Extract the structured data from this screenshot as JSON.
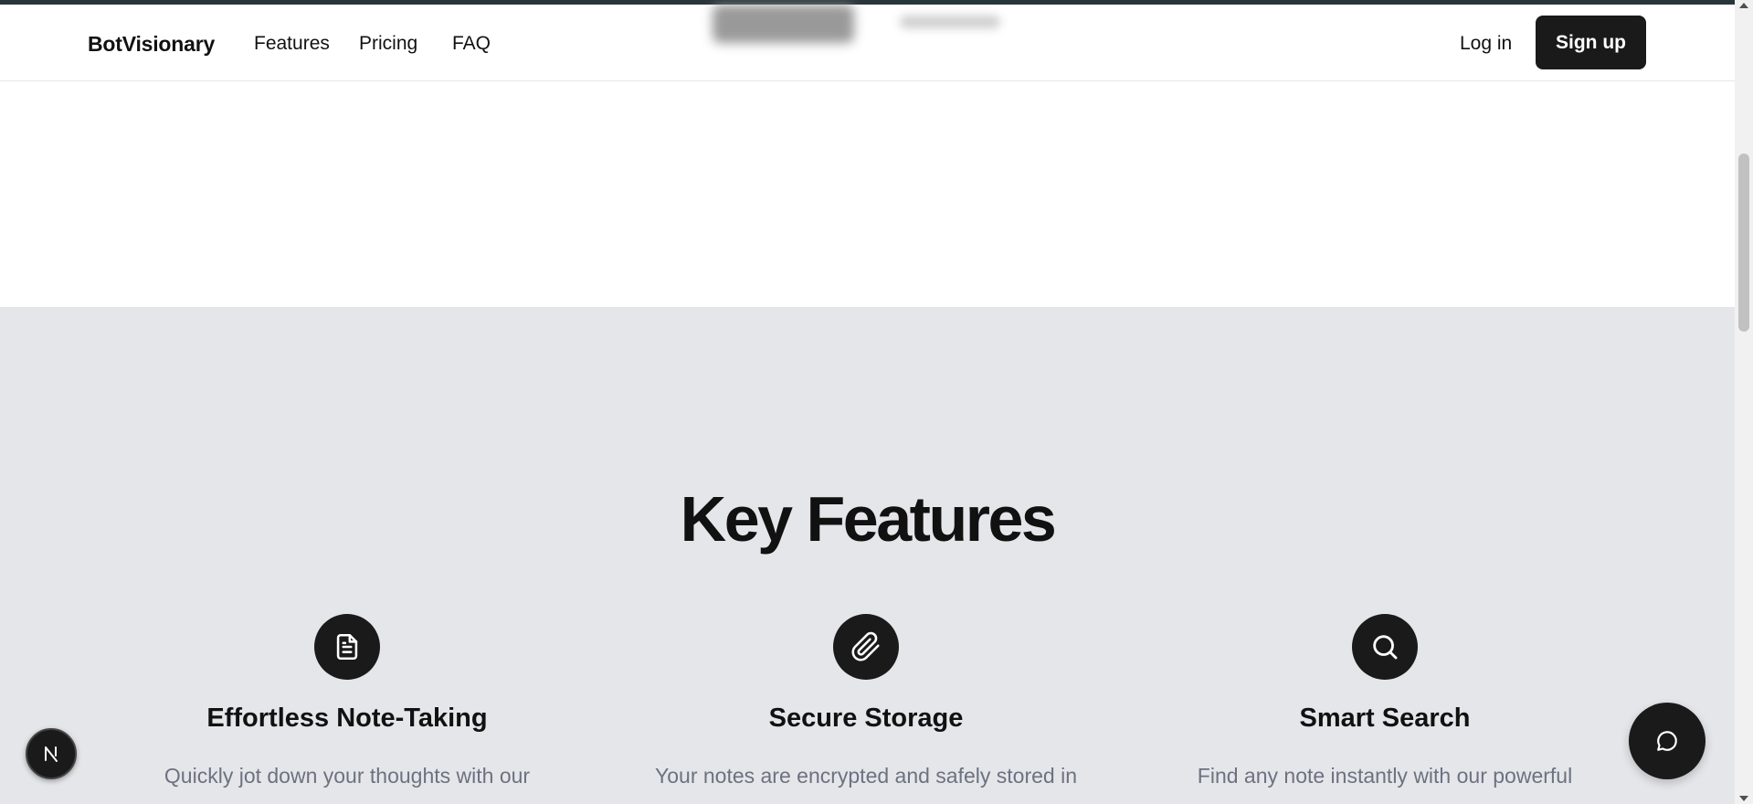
{
  "nav": {
    "brand": "BotVisionary",
    "links": [
      "Features",
      "Pricing",
      "FAQ"
    ],
    "login_label": "Log in",
    "signup_label": "Sign up"
  },
  "features_section": {
    "title": "Key Features",
    "items": [
      {
        "icon": "document-icon",
        "title": "Effortless Note-Taking",
        "description": "Quickly jot down your thoughts with our"
      },
      {
        "icon": "paperclip-icon",
        "title": "Secure Storage",
        "description": "Your notes are encrypted and safely stored in"
      },
      {
        "icon": "search-icon",
        "title": "Smart Search",
        "description": "Find any note instantly with our powerful"
      }
    ]
  },
  "floating": {
    "next_badge_icon": "nextjs-logo-icon",
    "chat_icon": "chat-bubble-icon"
  },
  "colors": {
    "primary": "#1a1a1a",
    "section_bg": "#e5e6ea",
    "muted_text": "#6b7280"
  }
}
